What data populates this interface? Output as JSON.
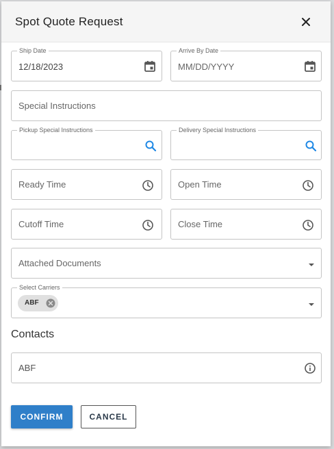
{
  "dialog": {
    "title": "Spot Quote Request"
  },
  "fields": {
    "ship_date": {
      "label": "Ship Date",
      "value": "12/18/2023"
    },
    "arrive_by_date": {
      "label": "Arrive By Date",
      "placeholder": "MM/DD/YYYY"
    },
    "special_instructions": {
      "placeholder": "Special Instructions"
    },
    "pickup_special_instructions": {
      "label": "Pickup Special Instructions"
    },
    "delivery_special_instructions": {
      "label": "Delivery Special Instructions"
    },
    "ready_time": {
      "placeholder": "Ready Time"
    },
    "open_time": {
      "placeholder": "Open Time"
    },
    "cutoff_time": {
      "placeholder": "Cutoff Time"
    },
    "close_time": {
      "placeholder": "Close Time"
    },
    "attached_documents": {
      "placeholder": "Attached Documents"
    },
    "select_carriers": {
      "label": "Select Carriers",
      "chips": [
        "ABF"
      ]
    }
  },
  "contacts": {
    "title": "Contacts",
    "value": "ABF"
  },
  "actions": {
    "confirm_label": "CONFIRM",
    "cancel_label": "CANCEL"
  },
  "colors": {
    "primary": "#2f7fc9",
    "search_icon": "#1e88e5",
    "icon_gray": "#555555"
  },
  "icons": {
    "date": "calendar-icon",
    "search": "search-icon",
    "time": "clock-icon",
    "dropdown": "caret-down-icon",
    "info": "info-icon",
    "close": "close-icon",
    "chip_remove": "cancel-circle-icon"
  }
}
